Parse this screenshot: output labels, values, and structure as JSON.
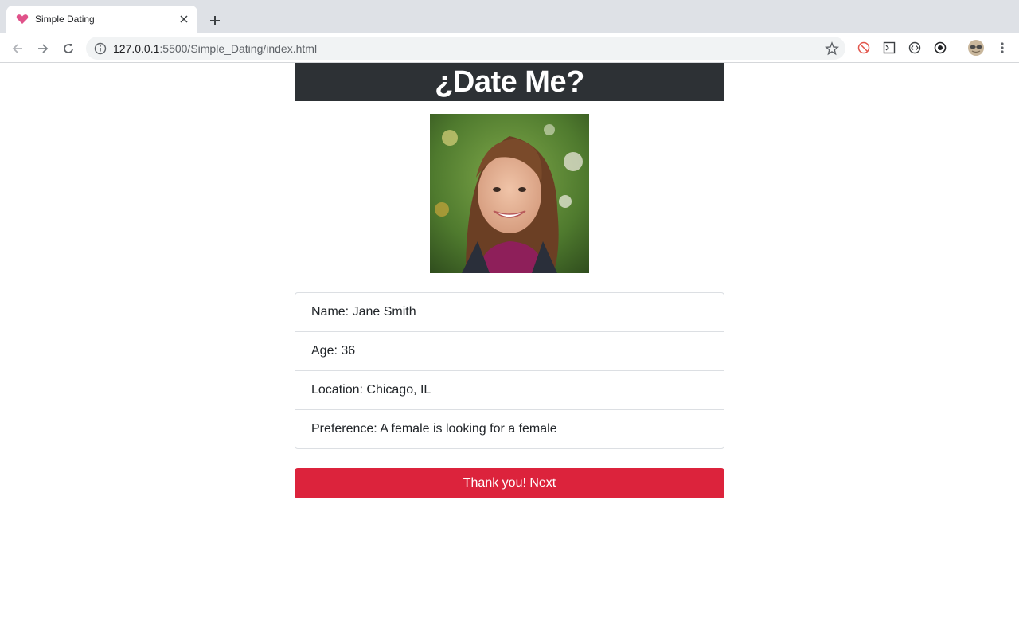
{
  "browser": {
    "tab_title": "Simple Dating",
    "url_host": "127.0.0.1",
    "url_rest": ":5500/Simple_Dating/index.html"
  },
  "page": {
    "heading": "¿Date Me?",
    "profile": {
      "name": "Name: Jane Smith",
      "age": "Age: 36",
      "location": "Location: Chicago, IL",
      "preference": "Preference: A female is looking for a female"
    },
    "next_button": "Thank you! Next"
  },
  "colors": {
    "header_bg": "#2d3135",
    "button_bg": "#dc233c"
  }
}
